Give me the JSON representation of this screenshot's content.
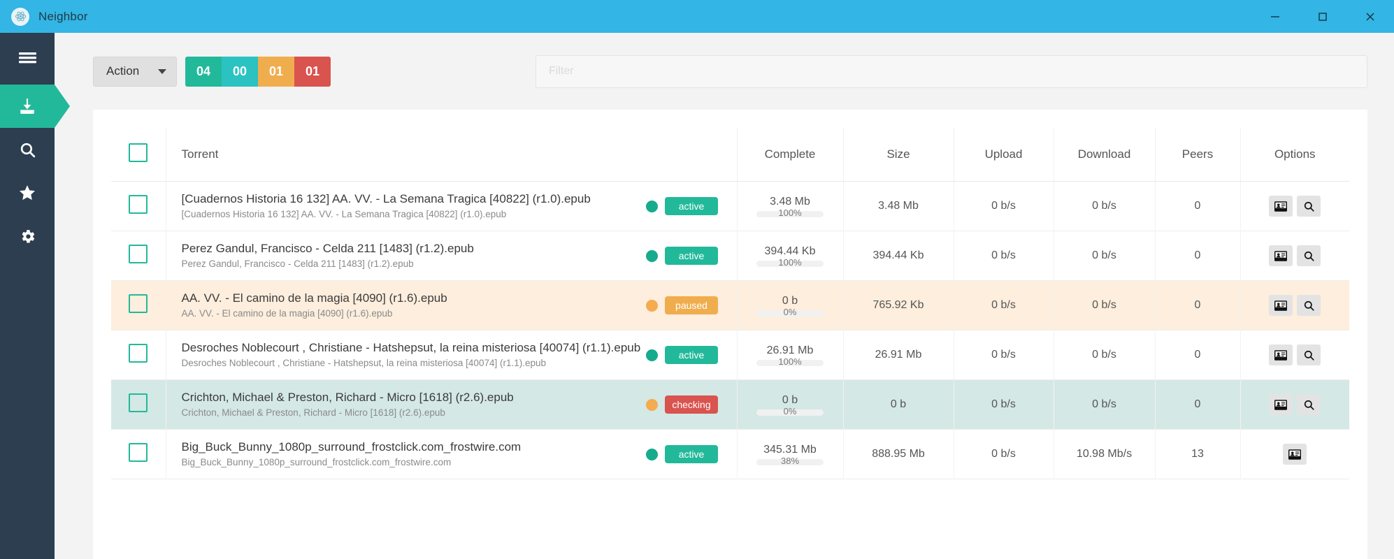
{
  "window": {
    "title": "Neighbor",
    "logo_icon": "atom-icon",
    "minimize_icon": "minimize-icon",
    "maximize_icon": "maximize-icon",
    "close_icon": "close-icon",
    "titlebar_color": "#33b5e5"
  },
  "sidebar": {
    "background": "#2c3e50",
    "active_color": "#22b99a",
    "items": [
      {
        "name": "menu",
        "icon": "hamburger-menu-icon",
        "active": false
      },
      {
        "name": "downloads",
        "icon": "download-icon",
        "active": true
      },
      {
        "name": "search",
        "icon": "search-icon",
        "active": false
      },
      {
        "name": "favorites",
        "icon": "star-icon",
        "active": false
      },
      {
        "name": "settings",
        "icon": "gear-icon",
        "active": false
      }
    ]
  },
  "toolbar": {
    "action_label": "Action",
    "caret_icon": "chevron-down-icon",
    "badges": [
      {
        "value": "04",
        "color": "#22b99a"
      },
      {
        "value": "00",
        "color": "#2bc2c2"
      },
      {
        "value": "01",
        "color": "#f0ad4e"
      },
      {
        "value": "01",
        "color": "#d9534f"
      }
    ]
  },
  "search": {
    "placeholder": "Filter",
    "value": ""
  },
  "table": {
    "headers": {
      "select_all": "",
      "torrent": "Torrent",
      "complete": "Complete",
      "size": "Size",
      "upload": "Upload",
      "download": "Download",
      "peers": "Peers",
      "options": "Options"
    },
    "status_colors": {
      "active": "#22b99a",
      "paused": "#f0ad4e",
      "checking": "#d9534f",
      "dot_active": "#15ab8c",
      "dot_paused": "#f5ab4f",
      "dot_checking": "#f5ab4f"
    },
    "rows": [
      {
        "name": "[Cuadernos Historia 16 132] AA. VV. - La Semana Tragica [40822] (r1.0).epub",
        "subname": "[Cuadernos Historia 16 132] AA. VV. - La Semana Tragica [40822] (r1.0).epub",
        "status": "active",
        "complete": "3.48 Mb",
        "percent": "100%",
        "percent_value": 100,
        "size": "3.48 Mb",
        "upload": "0 b/s",
        "download": "0 b/s",
        "peers": "0",
        "options": [
          "contact-card-icon",
          "magnifier-icon"
        ],
        "highlight": "none"
      },
      {
        "name": "Perez Gandul, Francisco - Celda 211 [1483] (r1.2).epub",
        "subname": "Perez Gandul, Francisco - Celda 211 [1483] (r1.2).epub",
        "status": "active",
        "complete": "394.44 Kb",
        "percent": "100%",
        "percent_value": 100,
        "size": "394.44 Kb",
        "upload": "0 b/s",
        "download": "0 b/s",
        "peers": "0",
        "options": [
          "contact-card-icon",
          "magnifier-icon"
        ],
        "highlight": "none"
      },
      {
        "name": "AA. VV. - El camino de la magia [4090] (r1.6).epub",
        "subname": "AA. VV. - El camino de la magia [4090] (r1.6).epub",
        "status": "paused",
        "complete": "0 b",
        "percent": "0%",
        "percent_value": 0,
        "size": "765.92 Kb",
        "upload": "0 b/s",
        "download": "0 b/s",
        "peers": "0",
        "options": [
          "contact-card-icon",
          "magnifier-icon"
        ],
        "highlight": "paused"
      },
      {
        "name": "Desroches Noblecourt , Christiane - Hatshepsut, la reina misteriosa [40074] (r1.1).epub",
        "subname": "Desroches Noblecourt , Christiane - Hatshepsut, la reina misteriosa [40074] (r1.1).epub",
        "status": "active",
        "complete": "26.91 Mb",
        "percent": "100%",
        "percent_value": 100,
        "size": "26.91 Mb",
        "upload": "0 b/s",
        "download": "0 b/s",
        "peers": "0",
        "options": [
          "contact-card-icon",
          "magnifier-icon"
        ],
        "highlight": "none"
      },
      {
        "name": "Crichton, Michael & Preston, Richard - Micro [1618] (r2.6).epub",
        "subname": "Crichton, Michael & Preston, Richard - Micro [1618] (r2.6).epub",
        "status": "checking",
        "complete": "0 b",
        "percent": "0%",
        "percent_value": 0,
        "size": "0 b",
        "upload": "0 b/s",
        "download": "0 b/s",
        "peers": "0",
        "options": [
          "contact-card-icon",
          "magnifier-icon"
        ],
        "highlight": "checking"
      },
      {
        "name": "Big_Buck_Bunny_1080p_surround_frostclick.com_frostwire.com",
        "subname": "Big_Buck_Bunny_1080p_surround_frostclick.com_frostwire.com",
        "status": "active",
        "complete": "345.31 Mb",
        "percent": "38%",
        "percent_value": 38,
        "size": "888.95 Mb",
        "upload": "0 b/s",
        "download": "10.98 Mb/s",
        "peers": "13",
        "options": [
          "contact-card-icon"
        ],
        "highlight": "none"
      }
    ]
  }
}
